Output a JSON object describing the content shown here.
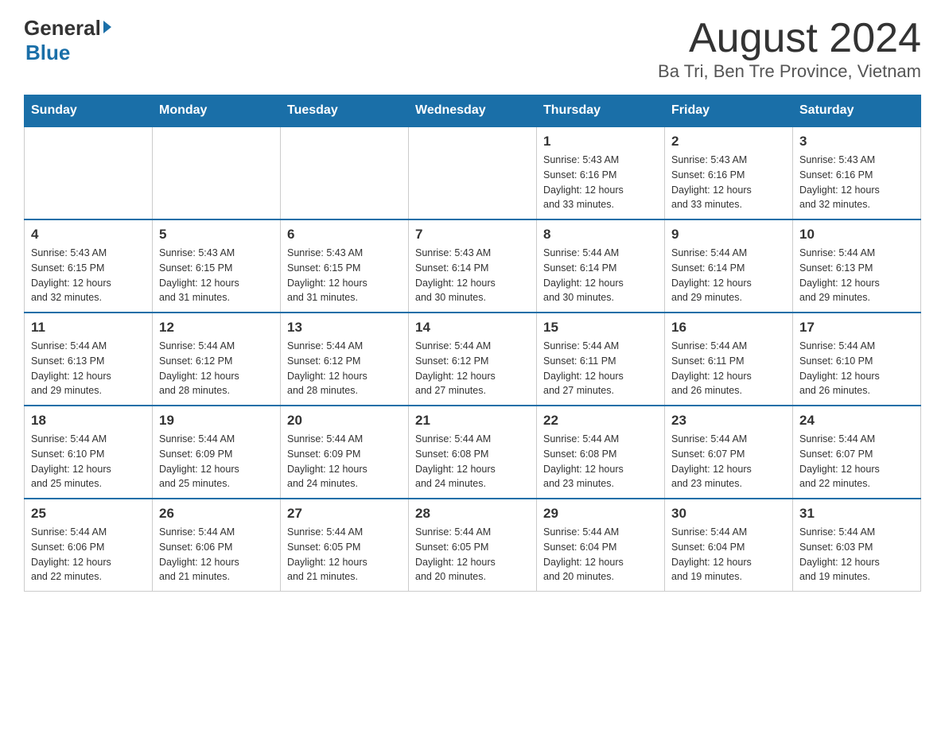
{
  "logo": {
    "general": "General",
    "blue": "Blue"
  },
  "title": "August 2024",
  "subtitle": "Ba Tri, Ben Tre Province, Vietnam",
  "weekdays": [
    "Sunday",
    "Monday",
    "Tuesday",
    "Wednesday",
    "Thursday",
    "Friday",
    "Saturday"
  ],
  "weeks": [
    [
      {
        "day": "",
        "info": ""
      },
      {
        "day": "",
        "info": ""
      },
      {
        "day": "",
        "info": ""
      },
      {
        "day": "",
        "info": ""
      },
      {
        "day": "1",
        "info": "Sunrise: 5:43 AM\nSunset: 6:16 PM\nDaylight: 12 hours\nand 33 minutes."
      },
      {
        "day": "2",
        "info": "Sunrise: 5:43 AM\nSunset: 6:16 PM\nDaylight: 12 hours\nand 33 minutes."
      },
      {
        "day": "3",
        "info": "Sunrise: 5:43 AM\nSunset: 6:16 PM\nDaylight: 12 hours\nand 32 minutes."
      }
    ],
    [
      {
        "day": "4",
        "info": "Sunrise: 5:43 AM\nSunset: 6:15 PM\nDaylight: 12 hours\nand 32 minutes."
      },
      {
        "day": "5",
        "info": "Sunrise: 5:43 AM\nSunset: 6:15 PM\nDaylight: 12 hours\nand 31 minutes."
      },
      {
        "day": "6",
        "info": "Sunrise: 5:43 AM\nSunset: 6:15 PM\nDaylight: 12 hours\nand 31 minutes."
      },
      {
        "day": "7",
        "info": "Sunrise: 5:43 AM\nSunset: 6:14 PM\nDaylight: 12 hours\nand 30 minutes."
      },
      {
        "day": "8",
        "info": "Sunrise: 5:44 AM\nSunset: 6:14 PM\nDaylight: 12 hours\nand 30 minutes."
      },
      {
        "day": "9",
        "info": "Sunrise: 5:44 AM\nSunset: 6:14 PM\nDaylight: 12 hours\nand 29 minutes."
      },
      {
        "day": "10",
        "info": "Sunrise: 5:44 AM\nSunset: 6:13 PM\nDaylight: 12 hours\nand 29 minutes."
      }
    ],
    [
      {
        "day": "11",
        "info": "Sunrise: 5:44 AM\nSunset: 6:13 PM\nDaylight: 12 hours\nand 29 minutes."
      },
      {
        "day": "12",
        "info": "Sunrise: 5:44 AM\nSunset: 6:12 PM\nDaylight: 12 hours\nand 28 minutes."
      },
      {
        "day": "13",
        "info": "Sunrise: 5:44 AM\nSunset: 6:12 PM\nDaylight: 12 hours\nand 28 minutes."
      },
      {
        "day": "14",
        "info": "Sunrise: 5:44 AM\nSunset: 6:12 PM\nDaylight: 12 hours\nand 27 minutes."
      },
      {
        "day": "15",
        "info": "Sunrise: 5:44 AM\nSunset: 6:11 PM\nDaylight: 12 hours\nand 27 minutes."
      },
      {
        "day": "16",
        "info": "Sunrise: 5:44 AM\nSunset: 6:11 PM\nDaylight: 12 hours\nand 26 minutes."
      },
      {
        "day": "17",
        "info": "Sunrise: 5:44 AM\nSunset: 6:10 PM\nDaylight: 12 hours\nand 26 minutes."
      }
    ],
    [
      {
        "day": "18",
        "info": "Sunrise: 5:44 AM\nSunset: 6:10 PM\nDaylight: 12 hours\nand 25 minutes."
      },
      {
        "day": "19",
        "info": "Sunrise: 5:44 AM\nSunset: 6:09 PM\nDaylight: 12 hours\nand 25 minutes."
      },
      {
        "day": "20",
        "info": "Sunrise: 5:44 AM\nSunset: 6:09 PM\nDaylight: 12 hours\nand 24 minutes."
      },
      {
        "day": "21",
        "info": "Sunrise: 5:44 AM\nSunset: 6:08 PM\nDaylight: 12 hours\nand 24 minutes."
      },
      {
        "day": "22",
        "info": "Sunrise: 5:44 AM\nSunset: 6:08 PM\nDaylight: 12 hours\nand 23 minutes."
      },
      {
        "day": "23",
        "info": "Sunrise: 5:44 AM\nSunset: 6:07 PM\nDaylight: 12 hours\nand 23 minutes."
      },
      {
        "day": "24",
        "info": "Sunrise: 5:44 AM\nSunset: 6:07 PM\nDaylight: 12 hours\nand 22 minutes."
      }
    ],
    [
      {
        "day": "25",
        "info": "Sunrise: 5:44 AM\nSunset: 6:06 PM\nDaylight: 12 hours\nand 22 minutes."
      },
      {
        "day": "26",
        "info": "Sunrise: 5:44 AM\nSunset: 6:06 PM\nDaylight: 12 hours\nand 21 minutes."
      },
      {
        "day": "27",
        "info": "Sunrise: 5:44 AM\nSunset: 6:05 PM\nDaylight: 12 hours\nand 21 minutes."
      },
      {
        "day": "28",
        "info": "Sunrise: 5:44 AM\nSunset: 6:05 PM\nDaylight: 12 hours\nand 20 minutes."
      },
      {
        "day": "29",
        "info": "Sunrise: 5:44 AM\nSunset: 6:04 PM\nDaylight: 12 hours\nand 20 minutes."
      },
      {
        "day": "30",
        "info": "Sunrise: 5:44 AM\nSunset: 6:04 PM\nDaylight: 12 hours\nand 19 minutes."
      },
      {
        "day": "31",
        "info": "Sunrise: 5:44 AM\nSunset: 6:03 PM\nDaylight: 12 hours\nand 19 minutes."
      }
    ]
  ]
}
